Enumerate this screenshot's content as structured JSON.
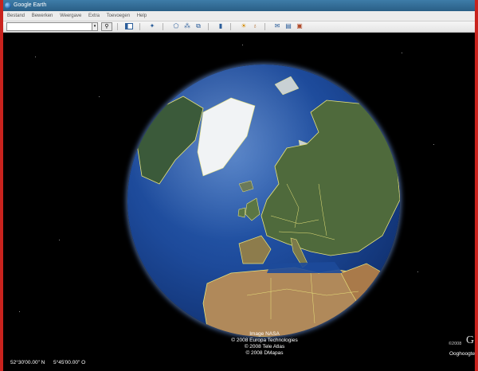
{
  "window": {
    "title": "Google Earth"
  },
  "menu": [
    "Bestand",
    "Bewerken",
    "Weergave",
    "Extra",
    "Toevoegen",
    "Help"
  ],
  "search": {
    "value": "",
    "dropdown_icon": "chevron-down-icon",
    "search_icon": "magnifier-icon"
  },
  "toolbar_icons": [
    "sidebar-toggle-icon",
    "placemark-icon",
    "polygon-icon",
    "path-icon",
    "image-overlay-icon",
    "ruler-icon",
    "sun-icon",
    "planet-icon",
    "email-icon",
    "print-icon",
    "view-in-maps-icon"
  ],
  "credits": {
    "image": "Image NASA",
    "line1": "© 2008 Europa Technologies",
    "line2": "© 2008 Tele Atlas",
    "line3": "© 2008 DMapas",
    "small": "©2008",
    "logo": "G"
  },
  "status": {
    "latitude": "52°30'00.00\" N",
    "longitude": "5°45'00.00\" O",
    "eye_alt_label": "Ooghoogte"
  },
  "colors": {
    "frame": "#c9231e",
    "titlebar": "#3e7ca8",
    "ocean": "#1d4a9a",
    "borders": "#e8e27a"
  }
}
